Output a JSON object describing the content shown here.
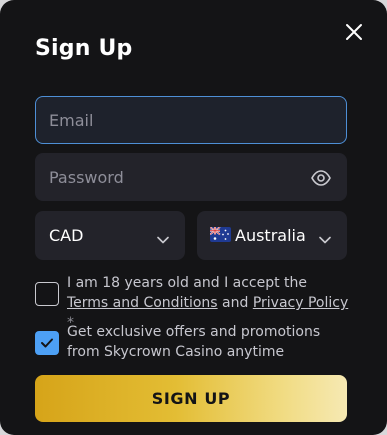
{
  "modal": {
    "title": "Sign Up"
  },
  "form": {
    "email_placeholder": "Email",
    "password_placeholder": "Password",
    "currency": "CAD",
    "country": "Australia",
    "terms": {
      "prefix": "I am 18 years old and I accept the",
      "terms_link": "Terms and Conditions",
      "and": "and",
      "privacy_link": "Privacy Policy",
      "required_marker": "*",
      "checked": false
    },
    "offers": {
      "text": "Get exclusive offers and promotions from Skycrown Casino anytime",
      "checked": true
    },
    "submit_label": "SIGN UP"
  },
  "icons": {
    "close": "close-icon",
    "eye": "eye-icon",
    "chevron": "chevron-down-icon",
    "flag": "australia-flag-icon",
    "check": "checkmark-icon"
  },
  "colors": {
    "background": "#141416",
    "field": "#23232a",
    "focus_border": "#4e8fd6",
    "checkbox_active": "#4da0f5",
    "button_gradient_start": "#d6a419",
    "button_gradient_end": "#f6e9b3"
  }
}
